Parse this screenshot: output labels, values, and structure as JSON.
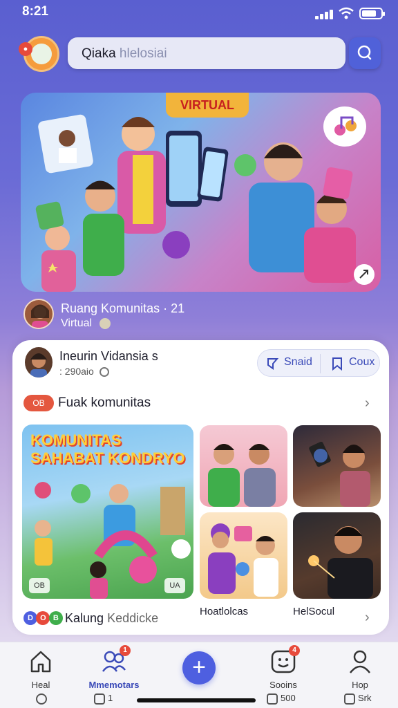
{
  "status_bar": {
    "time": "8:21"
  },
  "header": {
    "search_value": "Qiaka",
    "search_placeholder": "hlelosiai"
  },
  "hero": {
    "banner_text": "VIRTUAL",
    "community_name": "Ruang Komunitas  · 21",
    "community_sub": "Virtual"
  },
  "card": {
    "owner_name": "Ineurin Vidansia s",
    "owner_count": ": 290aio",
    "share_label": "Snaid",
    "join_label": "Coux",
    "section_badge": "OB",
    "section_title": "Fuak komunitas",
    "large_tile_title": "KOMUNITAS SAHABAT KONDRYO",
    "large_tile_badge_left": "OB",
    "large_tile_badge_right": "UA",
    "captions": [
      "Hoatlolcas",
      "HelSocul"
    ],
    "footer_badges": [
      "D",
      "O",
      "B"
    ],
    "footer_label": "Kalung",
    "footer_sub": "Keddicke"
  },
  "tab_bar": {
    "tabs": [
      {
        "label": "Heal",
        "icon": "home-icon"
      },
      {
        "label": "Mmemotars",
        "icon": "community-icon",
        "badge": "1"
      },
      {
        "label": "Sooins",
        "icon": "smiley-icon",
        "badge": "4"
      },
      {
        "label": "Hop",
        "icon": "profile-icon"
      }
    ],
    "sys_left": "1",
    "sys_right_a": "500",
    "sys_right_b": "Srk"
  },
  "colors": {
    "accent": "#4e5fe0",
    "badge_red": "#e74a3b",
    "bg_top": "#5a5fd0"
  }
}
